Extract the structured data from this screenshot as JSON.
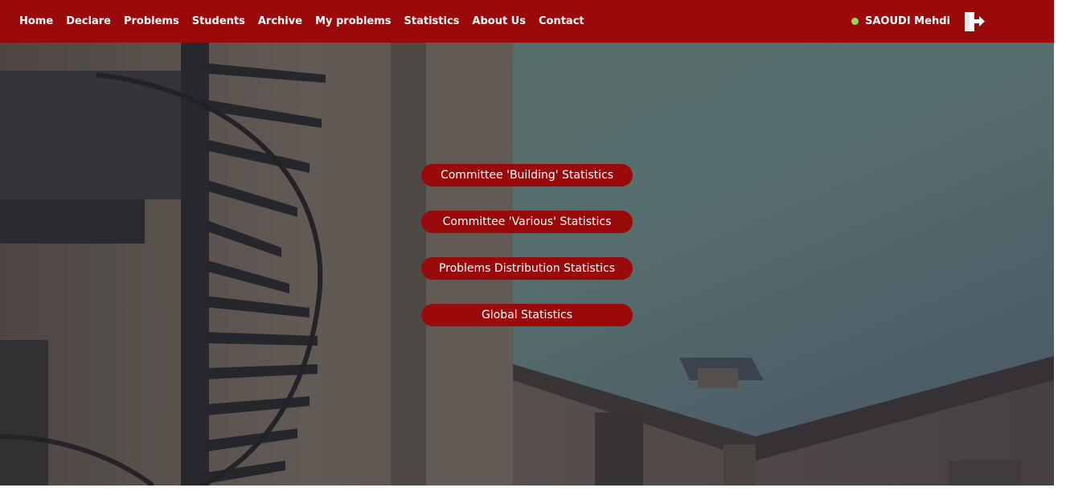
{
  "nav": {
    "items": [
      {
        "label": "Home"
      },
      {
        "label": "Declare"
      },
      {
        "label": "Problems"
      },
      {
        "label": "Students"
      },
      {
        "label": "Archive"
      },
      {
        "label": "My problems"
      },
      {
        "label": "Statistics"
      },
      {
        "label": "About Us"
      },
      {
        "label": "Contact"
      }
    ],
    "user": {
      "name": "SAOUDI Mehdi",
      "status": "online"
    },
    "logout_icon": "logout-door-icon"
  },
  "menu": {
    "buttons": [
      {
        "label": "Committee 'Building' Statistics"
      },
      {
        "label": "Committee 'Various' Statistics"
      },
      {
        "label": "Problems Distribution Statistics"
      },
      {
        "label": "Global Statistics"
      }
    ]
  },
  "colors": {
    "brand": "#9b0a0a",
    "status_online": "#8fdc5a",
    "text_on_brand": "#ffffff"
  }
}
